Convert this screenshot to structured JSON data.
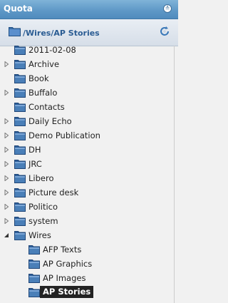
{
  "panel": {
    "title": "Quota",
    "collapse_icon": "double-chevron-down-icon"
  },
  "pathbar": {
    "path": "/Wires/AP Stories",
    "refresh_icon": "refresh-icon"
  },
  "tree": {
    "items": [
      {
        "label": "2011-02-08",
        "level": 1,
        "expandable": false,
        "expanded": false
      },
      {
        "label": "Archive",
        "level": 1,
        "expandable": true,
        "expanded": false
      },
      {
        "label": "Book",
        "level": 1,
        "expandable": false,
        "expanded": false
      },
      {
        "label": "Buffalo",
        "level": 1,
        "expandable": true,
        "expanded": false
      },
      {
        "label": "Contacts",
        "level": 1,
        "expandable": false,
        "expanded": false
      },
      {
        "label": "Daily Echo",
        "level": 1,
        "expandable": true,
        "expanded": false
      },
      {
        "label": "Demo Publication",
        "level": 1,
        "expandable": true,
        "expanded": false
      },
      {
        "label": "DH",
        "level": 1,
        "expandable": true,
        "expanded": false
      },
      {
        "label": "JRC",
        "level": 1,
        "expandable": true,
        "expanded": false
      },
      {
        "label": "Libero",
        "level": 1,
        "expandable": true,
        "expanded": false
      },
      {
        "label": "Picture desk",
        "level": 1,
        "expandable": true,
        "expanded": false
      },
      {
        "label": "Politico",
        "level": 1,
        "expandable": true,
        "expanded": false
      },
      {
        "label": "system",
        "level": 1,
        "expandable": true,
        "expanded": false
      },
      {
        "label": "Wires",
        "level": 1,
        "expandable": true,
        "expanded": true
      },
      {
        "label": "AFP Texts",
        "level": 2,
        "expandable": false,
        "expanded": false
      },
      {
        "label": "AP Graphics",
        "level": 2,
        "expandable": false,
        "expanded": false
      },
      {
        "label": "AP Images",
        "level": 2,
        "expandable": false,
        "expanded": false
      },
      {
        "label": "AP Stories",
        "level": 2,
        "expandable": false,
        "expanded": false,
        "selected": true
      }
    ]
  },
  "colors": {
    "header": "#5d97c6",
    "folder": "#4a7fb8",
    "selected_bg": "#222222"
  }
}
